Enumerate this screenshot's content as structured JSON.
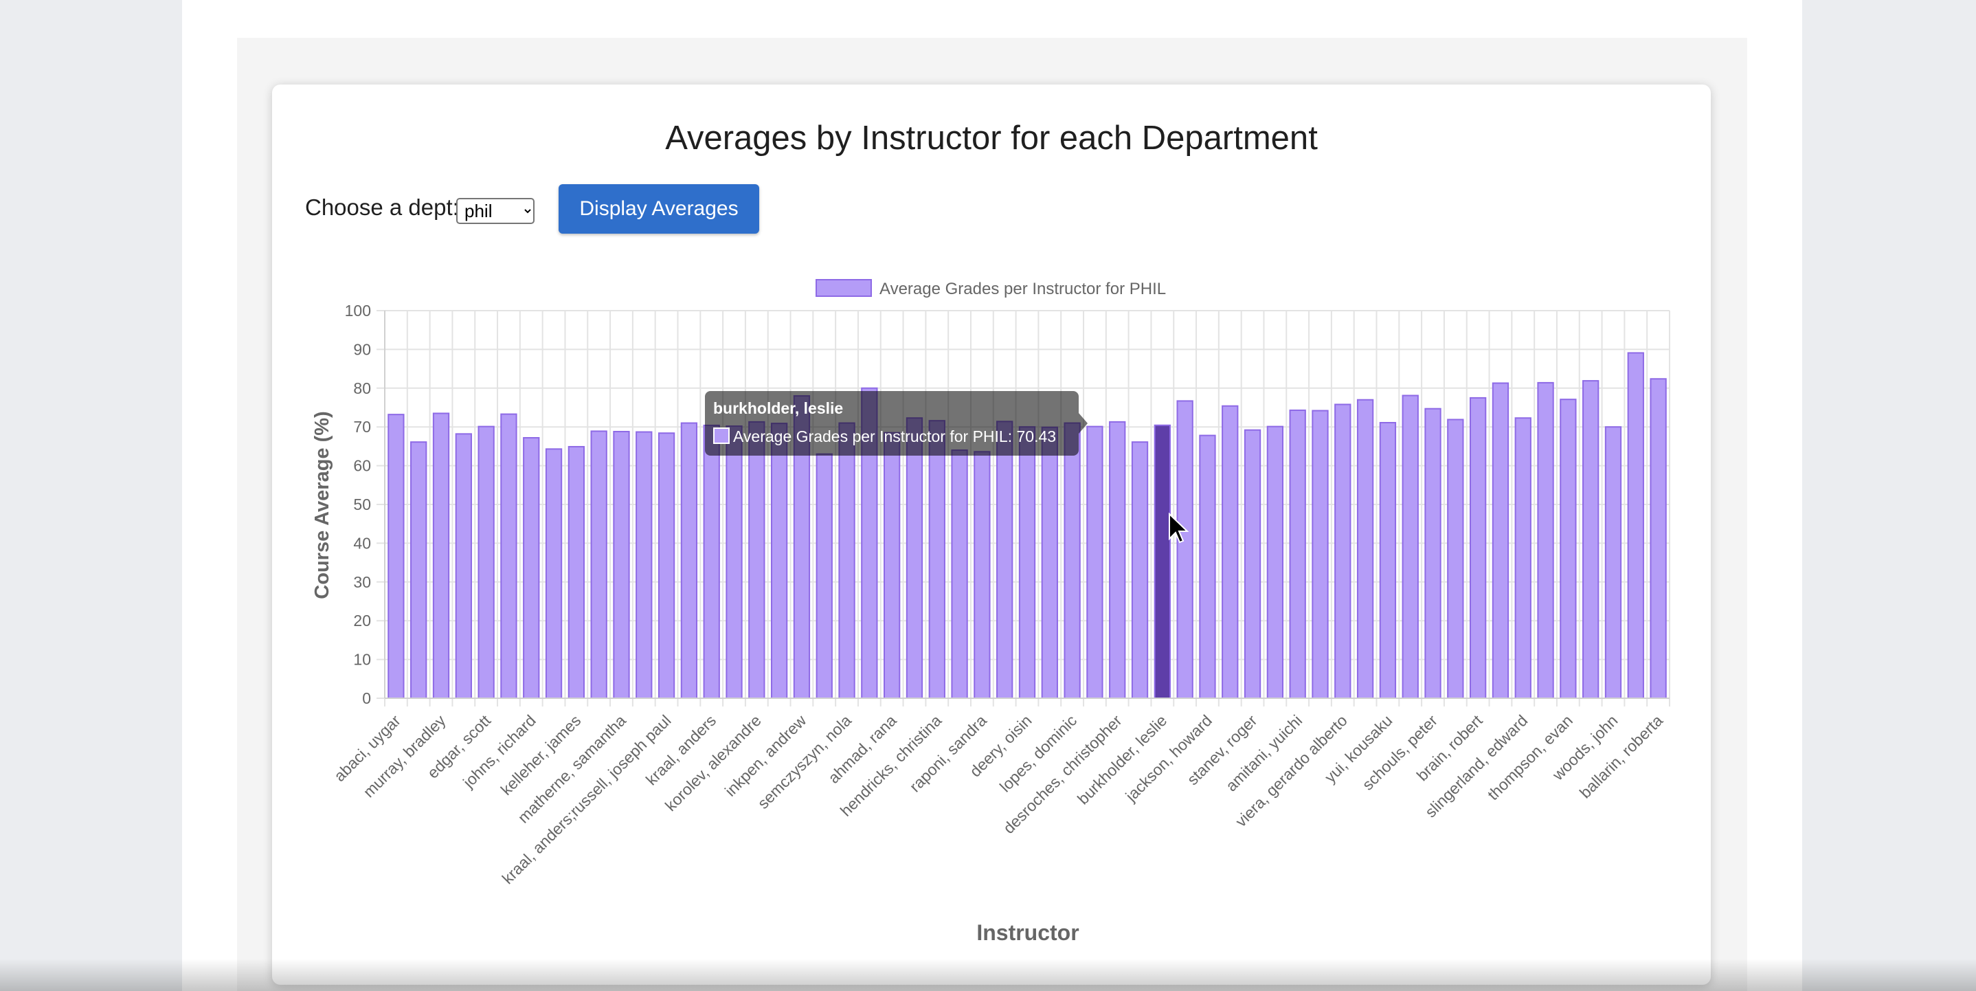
{
  "page": {
    "title": "Averages by Instructor for each Department",
    "dept_label": "Choose a dept:",
    "dept_selected": "phil",
    "display_button": "Display Averages"
  },
  "colors": {
    "bar_fill": "#b49cf7",
    "bar_border": "#8e6ae6",
    "bar_active": "#5e3ea8",
    "button": "#2f6fcb"
  },
  "tooltip": {
    "title": "burkholder, leslie",
    "label": "Average Grades per Instructor for PHIL: 70.43"
  },
  "chart_data": {
    "type": "bar",
    "title": "",
    "xlabel": "Instructor",
    "ylabel": "Course Average (%)",
    "ylim": [
      0,
      100
    ],
    "yticks": [
      0,
      10,
      20,
      30,
      40,
      50,
      60,
      70,
      80,
      90,
      100
    ],
    "grid": true,
    "legend_position": "top-center",
    "active_category": "burkholder, leslie",
    "categories": [
      "abaci, uygar",
      "",
      "murray, bradley",
      "",
      "edgar, scott",
      "",
      "johns, richard",
      "",
      "kelleher, james",
      "",
      "matherne, samantha",
      "",
      "kraal, anders;russell, joseph paul",
      "",
      "kraal, anders",
      "",
      "korolev, alexandre",
      "",
      "inkpen, andrew",
      "",
      "semczyszyn, nola",
      "",
      "ahmad, rana",
      "",
      "hendricks, christina",
      "",
      "raponi, sandra",
      "",
      "deery, oisin",
      "",
      "lopes, dominic",
      "",
      "desroches, christopher",
      "",
      "burkholder, leslie",
      "",
      "jackson, howard",
      "",
      "stanev, roger",
      "",
      "amitani, yuichi",
      "",
      "viera, gerardo alberto",
      "",
      "yui, kousaku",
      "",
      "schouls, peter",
      "",
      "brain, robert",
      "",
      "slingerland, edward",
      "",
      "thompson, evan",
      "",
      "woods, john",
      "",
      "ballarin, roberta"
    ],
    "series": [
      {
        "name": "Average Grades per Instructor for PHIL",
        "values": [
          73.2,
          66.1,
          73.5,
          68.2,
          70.1,
          73.3,
          67.2,
          64.3,
          64.9,
          68.9,
          68.8,
          68.7,
          68.4,
          71.0,
          70.4,
          70.2,
          71.3,
          70.9,
          78.0,
          63.0,
          71.0,
          80.0,
          68.5,
          72.3,
          71.6,
          64.0,
          63.6,
          71.4,
          70.0,
          69.9,
          71.0,
          70.1,
          71.3,
          66.1,
          70.43,
          76.7,
          67.8,
          75.4,
          69.2,
          70.1,
          74.3,
          74.2,
          75.8,
          77.0,
          71.1,
          78.1,
          74.7,
          71.9,
          77.5,
          81.3,
          72.3,
          81.4,
          77.1,
          81.9,
          70.0,
          89.1,
          82.4
        ]
      }
    ]
  }
}
